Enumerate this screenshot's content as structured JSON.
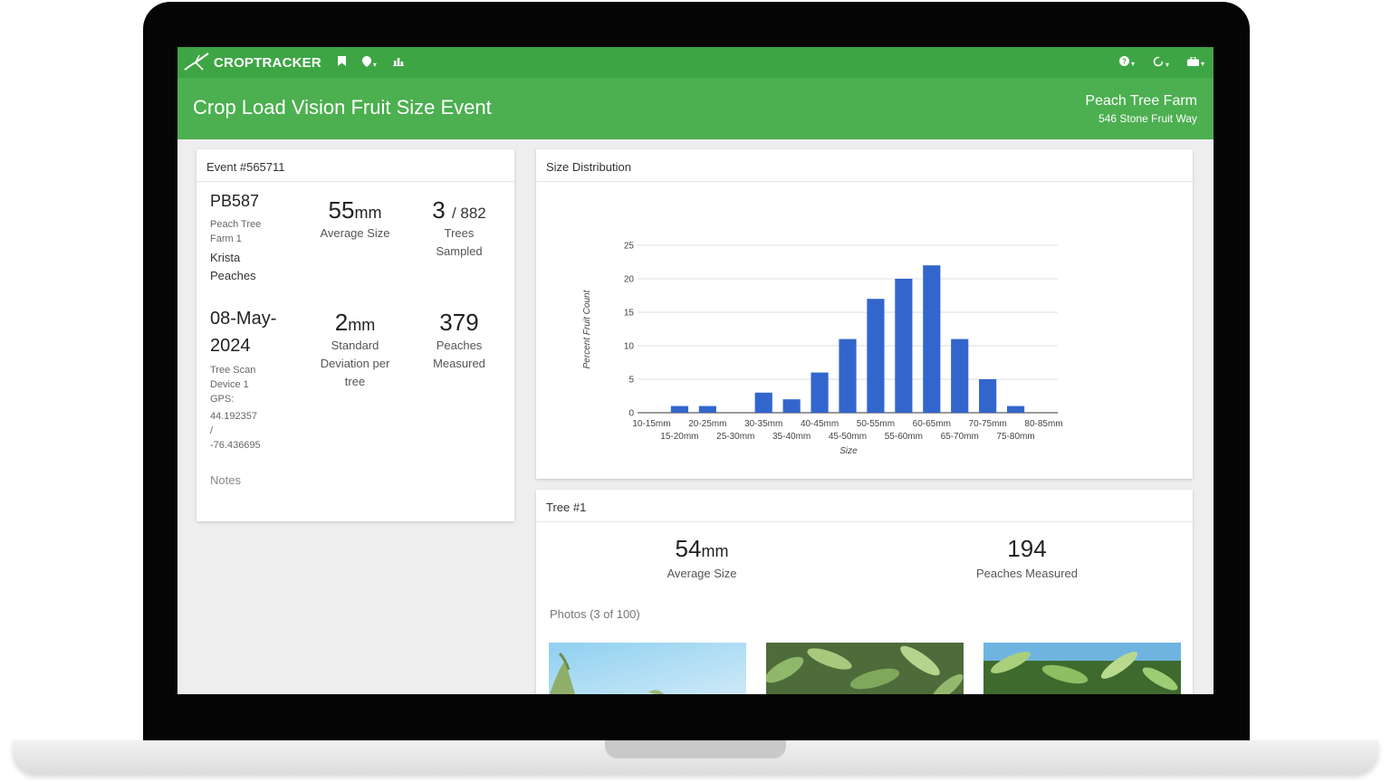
{
  "app": {
    "brand": "CROPTRACKER"
  },
  "nav": {
    "left_icons": [
      "bookmark-icon",
      "location-pin-icon",
      "chart-icon"
    ],
    "right_icons": [
      "help-icon",
      "sync-icon",
      "briefcase-icon"
    ],
    "caret": "▾"
  },
  "header": {
    "title": "Crop Load Vision Fruit Size Event",
    "farm_name": "Peach Tree Farm",
    "farm_address": "546 Stone Fruit Way"
  },
  "event": {
    "title": "Event #565711",
    "block_id": "PB587",
    "farm_line1": "Peach Tree",
    "farm_line2": "Farm 1",
    "variety": "Krista",
    "crop": "Peaches",
    "date_line1": "08-May-",
    "date_line2": "2024",
    "device_line1": "Tree Scan",
    "device_line2": "Device 1",
    "gps_label": "GPS:",
    "gps_lat": "44.192357",
    "gps_sep": "/",
    "gps_lon": "-76.436695",
    "notes_label": "Notes",
    "avg_size_value": "55",
    "avg_size_unit": "mm",
    "avg_size_label": "Average Size",
    "trees_sampled_value": "3",
    "trees_total": "/ 882",
    "trees_label_1": "Trees",
    "trees_label_2": "Sampled",
    "std_dev_value": "2",
    "std_dev_unit": "mm",
    "std_dev_label_1": "Standard",
    "std_dev_label_2": "Deviation per",
    "std_dev_label_3": "tree",
    "peaches_value": "379",
    "peaches_label_1": "Peaches",
    "peaches_label_2": "Measured"
  },
  "distribution": {
    "title": "Size Distribution"
  },
  "chart_data": {
    "type": "bar",
    "xlabel": "Size",
    "ylabel": "Percent Fruit Count",
    "ylim": [
      0,
      25
    ],
    "yticks": [
      0,
      5,
      10,
      15,
      20,
      25
    ],
    "grid": true,
    "legend": "none",
    "bar_color": "#3366cc",
    "categories": [
      "10-15mm",
      "15-20mm",
      "20-25mm",
      "25-30mm",
      "30-35mm",
      "35-40mm",
      "40-45mm",
      "45-50mm",
      "50-55mm",
      "55-60mm",
      "60-65mm",
      "65-70mm",
      "70-75mm",
      "75-80mm",
      "80-85mm"
    ],
    "values": [
      0,
      1,
      1,
      0,
      3,
      2,
      6,
      11,
      17,
      20,
      22,
      11,
      5,
      1,
      0
    ]
  },
  "tree": {
    "title": "Tree #1",
    "avg_size_value": "54",
    "avg_size_unit": "mm",
    "avg_size_label": "Average Size",
    "peaches_value": "194",
    "peaches_label": "Peaches Measured",
    "photos_label": "Photos (3 of 100)"
  }
}
